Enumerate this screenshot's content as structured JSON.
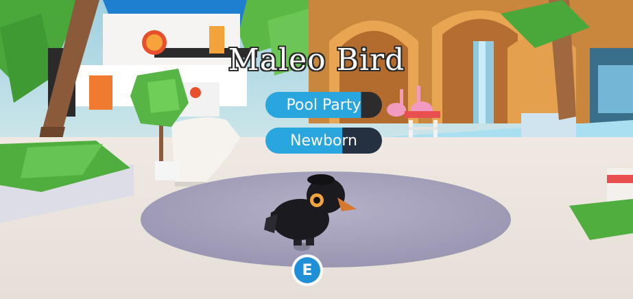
{
  "pet": {
    "name": "Maleo Bird",
    "tags": [
      {
        "label": "Pool Party",
        "accent": "#2aa6de"
      },
      {
        "label": "Newborn",
        "accent": "#2aa6de"
      }
    ]
  },
  "prompt": {
    "key": "E",
    "color": "#1f8fd8"
  }
}
